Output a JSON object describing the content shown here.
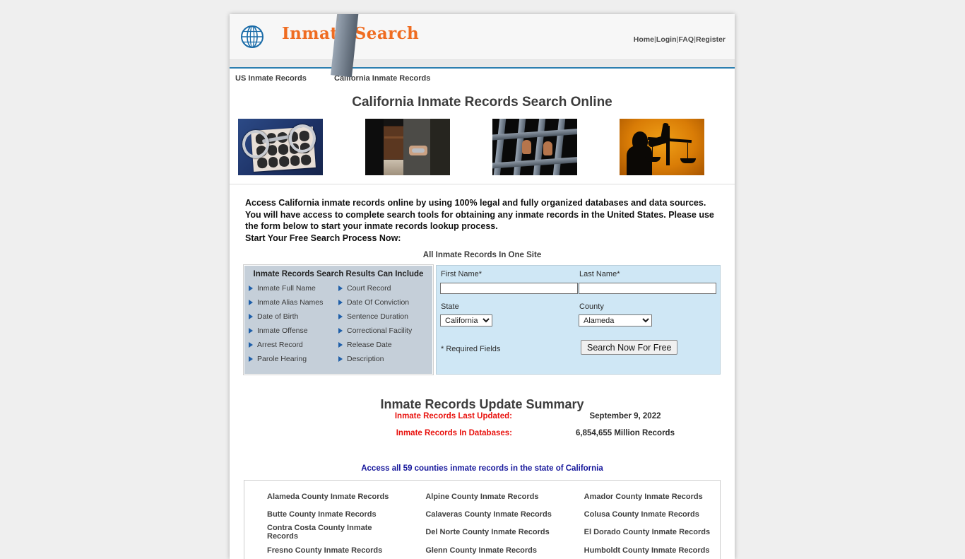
{
  "site": {
    "brand": "Inmate Search",
    "logo_icon": "globe-icon"
  },
  "topnav": {
    "items": [
      "Home",
      "Login",
      "FAQ",
      "Register"
    ],
    "separator": "|"
  },
  "breadcrumb": {
    "first": "US Inmate Records",
    "divider": "|",
    "second": "California Inmate Records"
  },
  "page_title": "California Inmate Records Search Online",
  "images": [
    {
      "alt": "handcuffs-on-fingerprint-card-image"
    },
    {
      "alt": "person-in-handcuffs-image"
    },
    {
      "alt": "hands-on-prison-bars-image"
    },
    {
      "alt": "lady-justice-scales-image"
    }
  ],
  "intro": {
    "paragraph": "Access California inmate records online by using 100% legal and fully organized databases and data sources. You will have access to complete search tools for obtaining any inmate records in the United States. Please use the form below to start your inmate records lookup process.",
    "cta": "Start Your Free Search Process Now:",
    "tagline": "All Inmate Records In One Site"
  },
  "features": {
    "title": "Inmate Records Search Results Can Include",
    "left": [
      "Inmate Full Name",
      "Inmate Alias Names",
      "Date of Birth",
      "Inmate Offense",
      "Arrest Record",
      "Parole Hearing"
    ],
    "right": [
      "Court Record",
      "Date Of Conviction",
      "Sentence Duration",
      "Correctional Facility",
      "Release Date",
      "Description"
    ]
  },
  "form": {
    "first_name_label": "First Name*",
    "first_name_value": "",
    "first_name_placeholder": "",
    "last_name_label": "Last Name*",
    "last_name_value": "",
    "last_name_placeholder": "",
    "state_label": "State",
    "state_value": "California",
    "county_label": "County",
    "county_value": "Alameda",
    "required_note": "* Required Fields",
    "submit_label": "Search Now For Free"
  },
  "summary": {
    "title": "Inmate Records Update Summary",
    "rows": [
      {
        "label": "Inmate Records Last Updated:",
        "value": "September 9, 2022"
      },
      {
        "label": "Inmate Records In Databases:",
        "value": "6,854,655 Million Records"
      }
    ]
  },
  "counties": {
    "heading": "Access all 59 counties inmate records in the state of California",
    "rows": [
      [
        "Alameda County Inmate Records",
        "Alpine County Inmate Records",
        "Amador County Inmate Records"
      ],
      [
        "Butte County Inmate Records",
        "Calaveras County Inmate Records",
        "Colusa County Inmate Records"
      ],
      [
        "Contra Costa County Inmate Records",
        "Del Norte County Inmate Records",
        "El Dorado County Inmate Records"
      ],
      [
        "Fresno County Inmate Records",
        "Glenn County Inmate Records",
        "Humboldt County Inmate Records"
      ]
    ]
  },
  "colors": {
    "brand_orange": "#ef6c21",
    "globe_blue": "#1b6ca8",
    "accent_rule": "#2c7fb0",
    "panel_left_bg": "#c5cfd9",
    "panel_right_bg": "#cfe7f5",
    "bullet_blue": "#1f5fa9",
    "summary_label_red": "#e8120e",
    "counties_heading_blue": "#15169b"
  }
}
